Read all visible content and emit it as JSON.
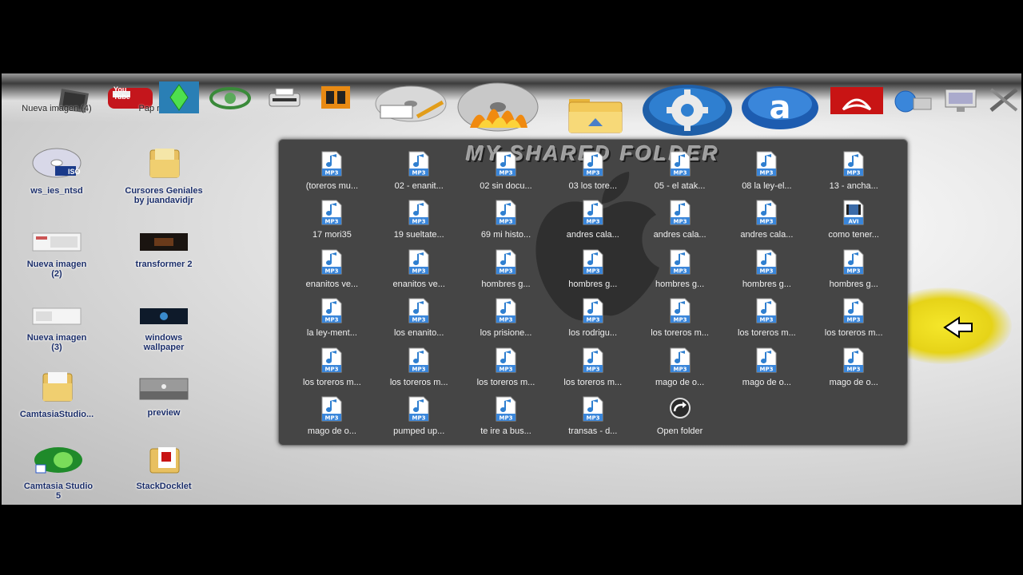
{
  "dock": {
    "items": [
      {
        "name": "nueva-imagen-4",
        "label": "Nueva imagen\n(4)"
      },
      {
        "name": "papelera-reciclaje",
        "label": "Pap\nreciclaje"
      },
      {
        "name": "sims",
        "label": ""
      },
      {
        "name": "alienware",
        "label": ""
      },
      {
        "name": "printer",
        "label": ""
      },
      {
        "name": "office",
        "label": ""
      },
      {
        "name": "cd-writer",
        "label": ""
      },
      {
        "name": "fire-burner",
        "label": ""
      },
      {
        "name": "shared-folder",
        "label": ""
      },
      {
        "name": "settings",
        "label": ""
      },
      {
        "name": "amazon",
        "label": ""
      },
      {
        "name": "acrobat",
        "label": ""
      },
      {
        "name": "network",
        "label": ""
      },
      {
        "name": "monitor",
        "label": ""
      },
      {
        "name": "tools",
        "label": ""
      }
    ],
    "youtube_text": "You\nTube"
  },
  "desktop": {
    "icons": [
      {
        "label": "ws_ies_ntsd",
        "type": "iso"
      },
      {
        "label": "Cursores Geniales\nby juandavidjr",
        "type": "folder"
      },
      {
        "label": "Nueva imagen\n(2)",
        "type": "image"
      },
      {
        "label": "transformer 2",
        "type": "video"
      },
      {
        "label": "Nueva imagen\n(3)",
        "type": "image"
      },
      {
        "label": "windows\nwallpaper",
        "type": "wallpaper"
      },
      {
        "label": "CamtasiaStudio...",
        "type": "folder"
      },
      {
        "label": "preview",
        "type": "preview"
      },
      {
        "label": "Camtasia Studio\n5",
        "type": "camtasia"
      },
      {
        "label": "StackDocklet",
        "type": "pdf-folder"
      }
    ],
    "iso_text": "ISO"
  },
  "stack": {
    "title": "MY SHARED FOLDER",
    "mp3_text": "MP3",
    "avi_text": "AVI",
    "files": [
      {
        "label": "(toreros mu...",
        "type": "mp3"
      },
      {
        "label": "02 - enanit...",
        "type": "mp3"
      },
      {
        "label": "02 sin docu...",
        "type": "mp3"
      },
      {
        "label": "03 los tore...",
        "type": "mp3"
      },
      {
        "label": "05 - el atak...",
        "type": "mp3"
      },
      {
        "label": "08 la ley-el...",
        "type": "mp3"
      },
      {
        "label": "13 - ancha...",
        "type": "mp3"
      },
      {
        "label": "17 mori35",
        "type": "mp3"
      },
      {
        "label": "19 sueltate...",
        "type": "mp3"
      },
      {
        "label": "69 mi histo...",
        "type": "mp3"
      },
      {
        "label": "andres cala...",
        "type": "mp3"
      },
      {
        "label": "andres cala...",
        "type": "mp3"
      },
      {
        "label": "andres cala...",
        "type": "mp3"
      },
      {
        "label": "como tener...",
        "type": "avi"
      },
      {
        "label": "enanitos ve...",
        "type": "mp3"
      },
      {
        "label": "enanitos ve...",
        "type": "mp3"
      },
      {
        "label": "hombres g...",
        "type": "mp3"
      },
      {
        "label": "hombres g...",
        "type": "mp3"
      },
      {
        "label": "hombres g...",
        "type": "mp3"
      },
      {
        "label": "hombres g...",
        "type": "mp3"
      },
      {
        "label": "hombres g...",
        "type": "mp3"
      },
      {
        "label": "la ley-ment...",
        "type": "mp3"
      },
      {
        "label": "los enanito...",
        "type": "mp3"
      },
      {
        "label": "los prisione...",
        "type": "mp3"
      },
      {
        "label": "los rodrigu...",
        "type": "mp3"
      },
      {
        "label": "los toreros m...",
        "type": "mp3"
      },
      {
        "label": "los toreros m...",
        "type": "mp3"
      },
      {
        "label": "los toreros m...",
        "type": "mp3"
      },
      {
        "label": "los toreros m...",
        "type": "mp3"
      },
      {
        "label": "los toreros m...",
        "type": "mp3"
      },
      {
        "label": "los toreros m...",
        "type": "mp3"
      },
      {
        "label": "los toreros m...",
        "type": "mp3"
      },
      {
        "label": "mago de o...",
        "type": "mp3"
      },
      {
        "label": "mago de o...",
        "type": "mp3"
      },
      {
        "label": "mago de o...",
        "type": "mp3"
      },
      {
        "label": "mago de o...",
        "type": "mp3"
      },
      {
        "label": "pumped up...",
        "type": "mp3"
      },
      {
        "label": "te ire a bus...",
        "type": "mp3"
      },
      {
        "label": "transas - d...",
        "type": "mp3"
      },
      {
        "label": "Open folder",
        "type": "open"
      }
    ]
  },
  "colors": {
    "stack_bg": "#454545",
    "cursor_highlight": "#f0de20"
  }
}
